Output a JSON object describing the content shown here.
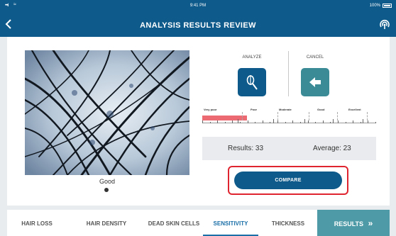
{
  "status_bar": {
    "time": "9:41 PM",
    "battery": "100%",
    "signal": "•••ıl",
    "wifi": "≈"
  },
  "header": {
    "title": "ANALYSIS RESULTS REVIEW",
    "back_icon": "chevron-left-icon",
    "right_icon": "signal-icon"
  },
  "image": {
    "caption": "Good"
  },
  "actions": {
    "analyze_label": "ANALYZE",
    "analyze_icon": "microscope-icon",
    "cancel_label": "CANCEL",
    "cancel_icon": "arrow-left-icon"
  },
  "scale": {
    "labels": [
      "Very poor",
      "Poor",
      "Moderate",
      "Good",
      "Excellent"
    ],
    "level": 0.26
  },
  "results": {
    "results_label": "Results:",
    "results_value": "33",
    "average_label": "Average:",
    "average_value": "23"
  },
  "compare_label": "COMPARE",
  "tabs": [
    {
      "label": "HAIR LOSS",
      "active": false
    },
    {
      "label": "HAIR DENSITY",
      "active": false
    },
    {
      "label": "DEAD SKIN CELLS",
      "active": false
    },
    {
      "label": "SENSITIVITY",
      "active": true
    },
    {
      "label": "THICKNESS",
      "active": false
    }
  ],
  "results_tab": {
    "label": "RESULTS",
    "icon": "double-chevron-right-icon"
  },
  "colors": {
    "header": "#0e5a8a",
    "accent": "#1a6fa8",
    "teal": "#4e9aa6",
    "scale_fill": "#ec6b73",
    "highlight": "#e0242f"
  }
}
